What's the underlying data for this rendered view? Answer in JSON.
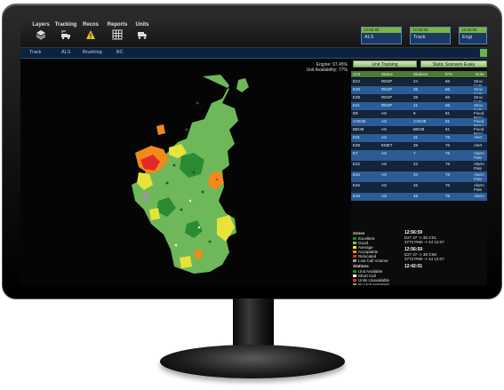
{
  "toolbar": {
    "tools": [
      {
        "label": "Layers",
        "icon": "layers-icon"
      },
      {
        "label": "Tracking",
        "icon": "tracking-icon"
      },
      {
        "label": "Recos",
        "icon": "warning-icon"
      },
      {
        "label": "Reports",
        "icon": "grid-icon"
      },
      {
        "label": "Units",
        "icon": "truck-icon"
      }
    ],
    "unit_chips": [
      {
        "time": "12:55:55",
        "label": "ALS"
      },
      {
        "time": "12:55:55",
        "label": "Track"
      },
      {
        "time": "12:55:55",
        "label": "Engi"
      }
    ]
  },
  "subnav": {
    "items": [
      "Track",
      "ALS",
      "Brushing",
      "BC"
    ]
  },
  "map": {
    "stats_line1": "Engine: 97.45%",
    "stats_line2": "Unit Availability: 77%"
  },
  "panel": {
    "buttons": [
      "Unit Tracking",
      "Static Scenario Evalu"
    ],
    "columns": [
      "Unit",
      "Status",
      "Stations",
      "ETA",
      "Note"
    ],
    "rows": [
      {
        "unit": "E24",
        "status": "RESP",
        "station": "24",
        "eta": "66",
        "note": "Struc Com"
      },
      {
        "unit": "E35",
        "status": "RESP",
        "station": "35",
        "eta": "66",
        "note": "Struc Com"
      },
      {
        "unit": "E38",
        "status": "RESP",
        "station": "38",
        "eta": "66",
        "note": "Struc Com"
      },
      {
        "unit": "E41",
        "status": "RESP",
        "station": "41",
        "eta": "66",
        "note": "Struc Com"
      },
      {
        "unit": "E9",
        "status": "AS",
        "station": "9",
        "eta": "81",
        "note": "Flood Reno"
      },
      {
        "unit": "CVE38",
        "status": "AS",
        "station": "CVE38",
        "eta": "81",
        "note": "Flood Reno"
      },
      {
        "unit": "BIE39",
        "status": "AS",
        "station": "BIE39",
        "eta": "81",
        "note": "Flood Reno"
      },
      {
        "unit": "E31",
        "status": "AS",
        "station": "31",
        "eta": "76",
        "note": "Alert"
      },
      {
        "unit": "E39",
        "status": "EMET",
        "station": "39",
        "eta": "76",
        "note": "Alert"
      },
      {
        "unit": "E7",
        "status": "AS",
        "station": "7",
        "eta": "76",
        "note": "Alarm Pale (LA)"
      },
      {
        "unit": "E22",
        "status": "AS",
        "station": "22",
        "eta": "76",
        "note": "Alarm Pale (LA)"
      },
      {
        "unit": "E34",
        "status": "AS",
        "station": "34",
        "eta": "76",
        "note": "Alarm Pale (LA)"
      },
      {
        "unit": "E45",
        "status": "AS",
        "station": "45",
        "eta": "76",
        "note": "Alarm Pale (LA)"
      },
      {
        "unit": "E46",
        "status": "AS",
        "station": "46",
        "eta": "76",
        "note": "Alarm"
      }
    ]
  },
  "legend": {
    "zones_title": "Zones",
    "zones": [
      {
        "label": "Excellent",
        "color": "#1f8a2a"
      },
      {
        "label": "Good",
        "color": "#7cc35a"
      },
      {
        "label": "Average",
        "color": "#e8e33a"
      },
      {
        "label": "Acceptable",
        "color": "#f08a1c"
      },
      {
        "label": "Relocated",
        "color": "#e4282a"
      },
      {
        "label": "Low Call Volume",
        "color": "#9a9a9a"
      }
    ],
    "stations_title": "Stations",
    "stations": [
      {
        "label": "Unit Available",
        "color": "#1f8a2a"
      },
      {
        "label": "Short Call",
        "color": "#ffffff"
      },
      {
        "label": "Units Unavailable",
        "color": "#e4282a"
      },
      {
        "label": "No Unit Assigned",
        "color": "#8a8a8a"
      }
    ]
  },
  "incidents": [
    {
      "time": "12:56:59",
      "line1": "E27     37 -> 38     3:01",
      "line2": "3773     PM0 -> 44     12:07"
    },
    {
      "time": "12:56:59",
      "line1": "E27     37 -> 38     3:58",
      "line2": "3773     PM0 -> 44     12:07"
    },
    {
      "time": "12:42:01",
      "line1": "",
      "line2": ""
    }
  ]
}
